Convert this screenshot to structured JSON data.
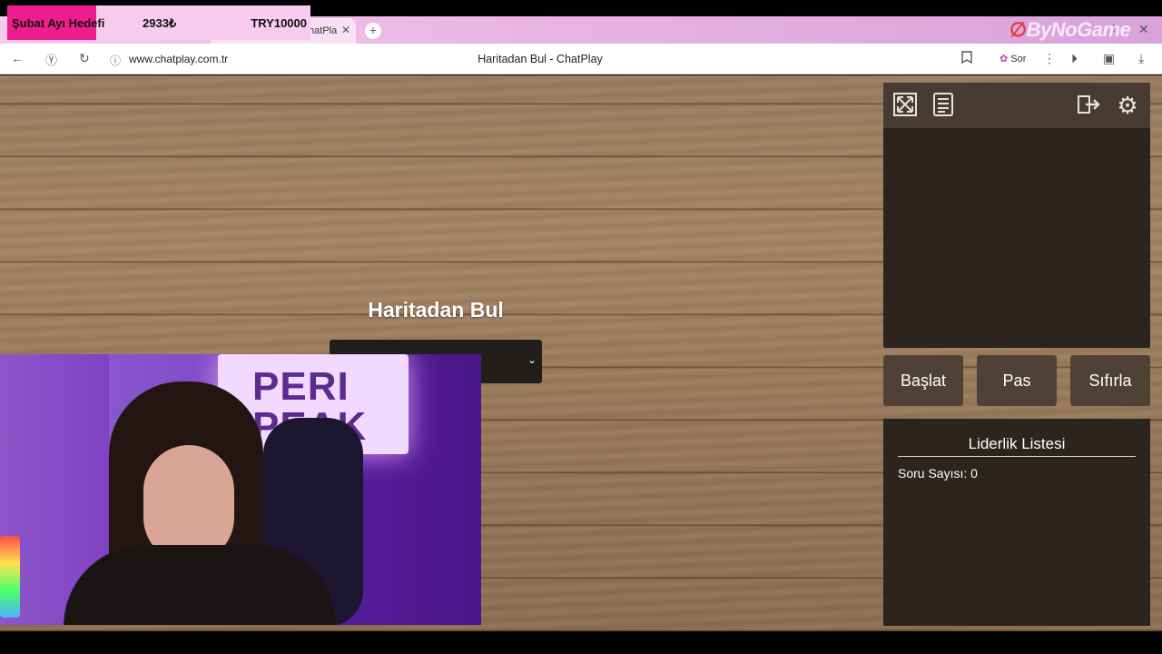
{
  "browser": {
    "tab_title": "hatPla",
    "url": "www.chatplay.com.tr",
    "page_title": "Haritadan Bul - ChatPlay",
    "sor_label": "Sor"
  },
  "donation": {
    "label": "Şubat Ayı Hedefi",
    "current": "2933₺",
    "goal": "TRY10000",
    "progress": 0.2933
  },
  "watermark": {
    "text": "ByNoGame"
  },
  "game": {
    "title": "Haritadan Bul",
    "selected_map": ""
  },
  "toolbar": {
    "icons": [
      "fullscreen-icon",
      "document-icon",
      "exit-icon",
      "gear-icon"
    ]
  },
  "controls": {
    "start": "Başlat",
    "pass": "Pas",
    "reset": "Sıfırla"
  },
  "leaderboard": {
    "title": "Liderlik Listesi",
    "question_count": "Soru Sayısı: 0"
  },
  "webcam": {
    "neon_sign": "PERI\nPEAK"
  },
  "colors": {
    "donation_fill": "#ee1d8f",
    "panel_bg": "#28211c",
    "button_bg": "#4b3e34"
  }
}
